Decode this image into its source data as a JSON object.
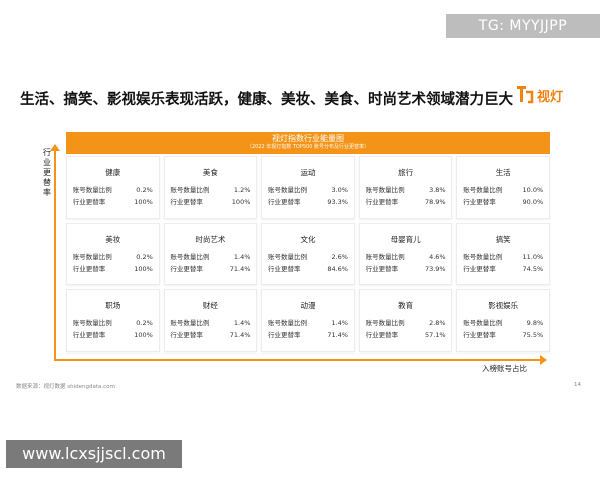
{
  "watermark_top": "TG: MYYJJPP",
  "watermark_bottom": "www.lcxsjjscl.com",
  "headline": "生活、搞笑、影视娱乐表现活跃，健康、美妆、美食、时尚艺术领域潜力巨大",
  "logo_text": "视灯",
  "chart_title": "视灯指数行业能量图",
  "chart_subtitle": "（2022 年视灯指数 TOP500 账号分布及行业更替率）",
  "y_axis_label": "行业更替率",
  "x_axis_label": "入榜账号占比",
  "source": "数据来源：视灯数据 shidengdata.com",
  "page_number": "14",
  "cells": [
    {
      "name": "健康",
      "label1": "账号数量比例",
      "value1": "0.2%",
      "label2": "行业更替率",
      "value2": "100%"
    },
    {
      "name": "美食",
      "label1": "账号数量比例",
      "value1": "1.2%",
      "label2": "行业更替率",
      "value2": "100%"
    },
    {
      "name": "运动",
      "label1": "账号数量比例",
      "value1": "3.0%",
      "label2": "行业更替率",
      "value2": "93.3%"
    },
    {
      "name": "旅行",
      "label1": "账号数量比例",
      "value1": "3.8%",
      "label2": "行业更替率",
      "value2": "78.9%"
    },
    {
      "name": "生活",
      "label1": "账号数量比例",
      "value1": "10.0%",
      "label2": "行业更替率",
      "value2": "90.0%"
    },
    {
      "name": "美妆",
      "label1": "账号数量比例",
      "value1": "0.2%",
      "label2": "行业更替率",
      "value2": "100%"
    },
    {
      "name": "时尚艺术",
      "label1": "账号数量比例",
      "value1": "1.4%",
      "label2": "行业更替率",
      "value2": "71.4%"
    },
    {
      "name": "文化",
      "label1": "账号数量比例",
      "value1": "2.6%",
      "label2": "行业更替率",
      "value2": "84.6%"
    },
    {
      "name": "母婴育儿",
      "label1": "账号数量比例",
      "value1": "4.6%",
      "label2": "行业更替率",
      "value2": "73.9%"
    },
    {
      "name": "搞笑",
      "label1": "账号数量比例",
      "value1": "11.0%",
      "label2": "行业更替率",
      "value2": "74.5%"
    },
    {
      "name": "职场",
      "label1": "账号数量比例",
      "value1": "0.2%",
      "label2": "行业更替率",
      "value2": "100%"
    },
    {
      "name": "财经",
      "label1": "账号数量比例",
      "value1": "1.4%",
      "label2": "行业更替率",
      "value2": "71.4%"
    },
    {
      "name": "动漫",
      "label1": "账号数量比例",
      "value1": "1.4%",
      "label2": "行业更替率",
      "value2": "71.4%"
    },
    {
      "name": "教育",
      "label1": "账号数量比例",
      "value1": "2.8%",
      "label2": "行业更替率",
      "value2": "57.1%"
    },
    {
      "name": "影视娱乐",
      "label1": "账号数量比例",
      "value1": "9.8%",
      "label2": "行业更替率",
      "value2": "75.5%"
    }
  ],
  "colors": {
    "accent": "#f39418",
    "logo": "#f0820f",
    "watermark_top_bg": "#bdbdbd",
    "watermark_bottom_bg": "#7a7a7a"
  }
}
